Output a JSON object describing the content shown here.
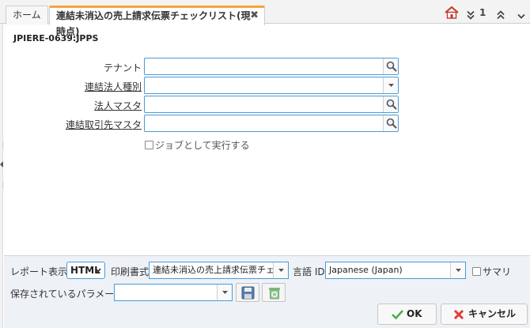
{
  "tabs": {
    "home": "ホーム",
    "active": "連結未消込の売上請求伝票チェックリスト(現時点)",
    "close": "✖",
    "count": "1"
  },
  "process_id": "JPIERE-0639:JPPS",
  "params": [
    {
      "label": "テナント",
      "type": "search"
    },
    {
      "label": "連結法人種別",
      "type": "dropdown"
    },
    {
      "label": "法人マスタ",
      "type": "search"
    },
    {
      "label": "連結取引先マスタ",
      "type": "search"
    }
  ],
  "run_as_job_label": "ジョブとして実行する",
  "bottom": {
    "report_display_label": "レポート表示",
    "report_display_value": "HTML",
    "print_format_label": "印刷書式",
    "print_format_value": "連結未消込の売上請求伝票チェ",
    "language_label": "言語 ID",
    "language_value": "Japanese (Japan)",
    "summary_label": "サマリ",
    "saved_params_label": "保存されているパラメータ",
    "saved_params_value": ""
  },
  "buttons": {
    "ok": "OK",
    "cancel": "キャンセル"
  },
  "colors": {
    "accent_tab": "#f3a73b",
    "field_border": "#4a9ad6",
    "ok_check": "#4caf50",
    "cancel_x": "#e53935"
  }
}
